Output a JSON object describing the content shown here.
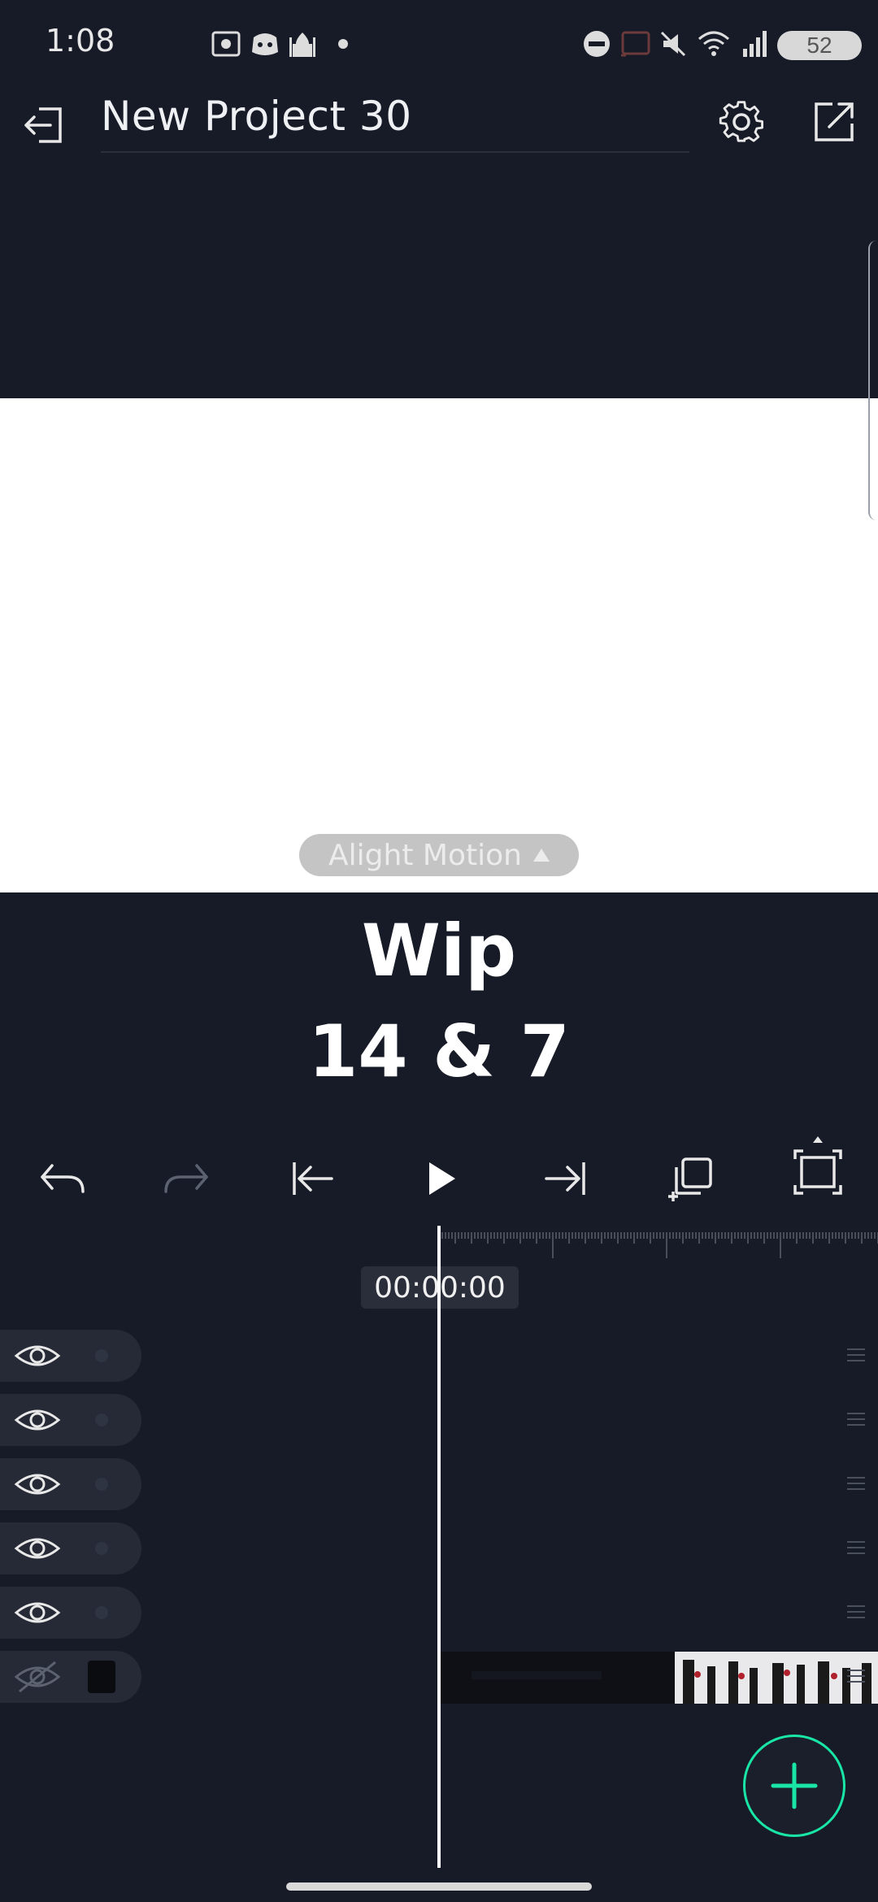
{
  "status_bar": {
    "time": "1:08",
    "battery": "52",
    "icons": [
      "screen-record-icon",
      "discord-icon",
      "mosque-icon",
      "dot-icon",
      "do-not-disturb-icon",
      "cast-icon",
      "mute-icon",
      "wifi-icon",
      "signal-icon",
      "battery-icon"
    ]
  },
  "app_bar": {
    "title": "New Project 30",
    "left_icon": "exit-icon",
    "right_icons": [
      "gear-icon",
      "share-export-icon"
    ]
  },
  "canvas": {
    "watermark": "Alight Motion",
    "text_line1": "Wip",
    "text_line2": "14 & 7",
    "background": "#ffffff"
  },
  "toolbar": {
    "icons": [
      "undo-icon",
      "redo-icon",
      "skip-to-start-icon",
      "play-icon",
      "skip-to-end-icon",
      "duplicate-icon",
      "fullscreen-icon"
    ]
  },
  "timeline": {
    "timecode": "00:00:00",
    "layers": [
      {
        "visible": true
      },
      {
        "visible": true
      },
      {
        "visible": true
      },
      {
        "visible": true
      },
      {
        "visible": true
      },
      {
        "visible": false
      }
    ]
  },
  "fab": {
    "icon": "plus-icon",
    "accent": "#19e6a6"
  },
  "colors": {
    "background": "#171b27",
    "accent": "#19e6a6",
    "layer_row": "#262a36"
  }
}
